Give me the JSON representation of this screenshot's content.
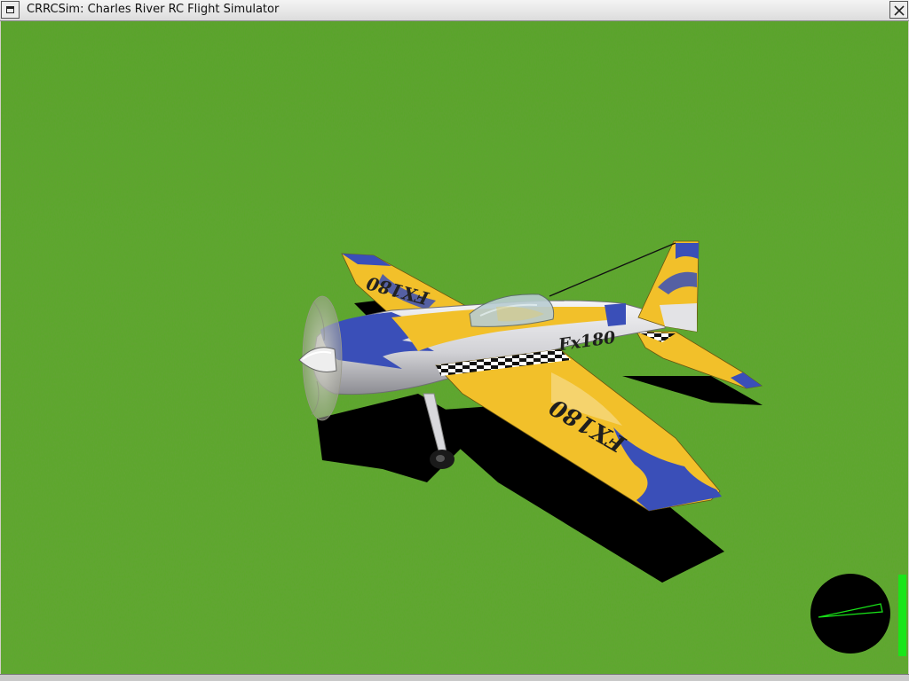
{
  "window": {
    "title": "CRRCSim: Charles River RC Flight Simulator",
    "menu_icon": "window-menu-icon",
    "close_icon": "close-icon"
  },
  "scene": {
    "ground": "grass",
    "aircraft": {
      "markings": "Fx180",
      "wing_markings": "FX180",
      "colors": {
        "primary": "#f2c02a",
        "secondary": "#3a4fb8",
        "fuselage": "#d8d8dc"
      }
    }
  },
  "hud": {
    "gauge_icon": "attitude-indicator-icon",
    "throttle_level": 1.0,
    "colors": {
      "gauge_line": "#18e018",
      "throttle": "#19e619"
    }
  }
}
